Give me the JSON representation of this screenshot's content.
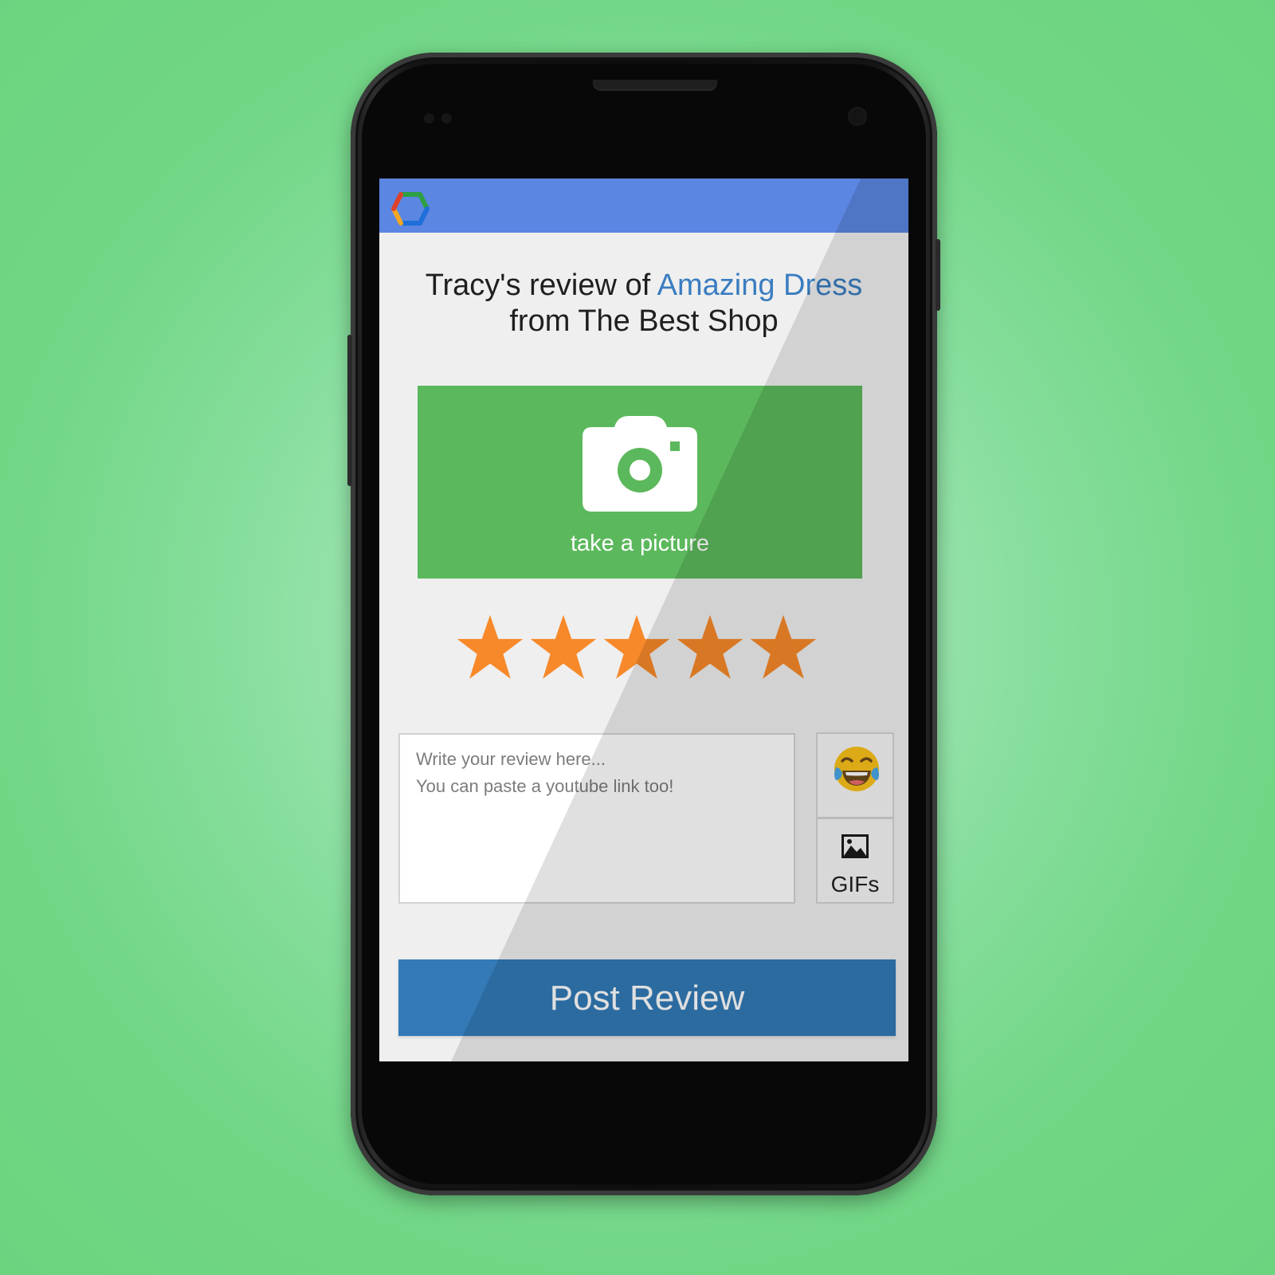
{
  "app": {
    "logo_icon": "hexagon-logo-icon",
    "accent_color": "#5b86e1"
  },
  "review": {
    "title_prefix": "Tracy's review of ",
    "product_name": "Amazing Dress",
    "title_suffix": "from The Best Shop"
  },
  "photo": {
    "icon": "camera-icon",
    "label": "take a picture",
    "color": "#5cb85c"
  },
  "rating": {
    "value": 5,
    "max": 5,
    "star_color": "#f7892a"
  },
  "review_input": {
    "placeholder_line1": "Write your review here...",
    "placeholder_line2": "You can paste a youtube link too!",
    "value": ""
  },
  "attachments": {
    "emoji_icon": "laughing-tears-emoji-icon",
    "gif_icon": "image-icon",
    "gif_label": "GIFs"
  },
  "actions": {
    "post_label": "Post Review",
    "post_color": "#337ab7"
  }
}
